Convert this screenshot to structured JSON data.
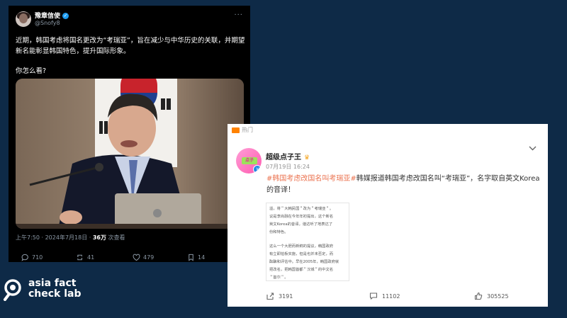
{
  "tweet": {
    "name": "豫章信使",
    "handle": "@Snofy8",
    "text_p1": "近期，韩国考虑将国名更改为“考瑞亚”，旨在减少与中华历史的关联，并期望新名能彰显韩国特色，提升国际形象。",
    "text_p2": "你怎么看?",
    "meta_time": "上午7:50 · 2024年7月18日 · ",
    "meta_views": "36万",
    "meta_views_label": " 次查看",
    "replies": "710",
    "retweets": "41",
    "likes": "479",
    "bookmarks": "14",
    "icons": {
      "more": "more-horizontal-icon",
      "reply": "reply-icon",
      "retweet": "retweet-icon",
      "like": "heart-icon",
      "bookmark": "bookmark-icon"
    }
  },
  "weibo": {
    "hot_label": "热门",
    "avatar_label": "超级点子王",
    "name": "超级点子王",
    "time": "07月19日 16:24",
    "hashtag1": "#韩国考虑改国名叫考瑞亚#",
    "hashtag2": "韩媒报道韩国考虑改国名叫“考瑞亚”，名字取自英文Korea的音译！",
    "image_lines": [
      "溢，将＂大韩民国＂改为＂考瑞亚＂。",
      "议是李尚融在今年年初提出，这个新名",
      "英文Korea的音译。谐达听了地表达了",
      "份和特色。",
      "",
      "这么一个大胆而新鲜的提议，韩国政府",
      "有立即拍板实施，但是也并未否定，而",
      "酝酿和评估中。早在2005年，韩国政府就",
      "把改名，把韩国首都＂汉城＂的中文名",
      "＂首尔＂。"
    ],
    "shares": "3191",
    "comments": "11102",
    "likes": "305525",
    "icons": {
      "chevron": "chevron-down-icon",
      "share": "share-icon",
      "comment": "comment-icon",
      "like": "thumbs-up-icon",
      "crown": "crown-icon"
    }
  },
  "logo": {
    "line1": "asia fact",
    "line2": "check lab"
  }
}
